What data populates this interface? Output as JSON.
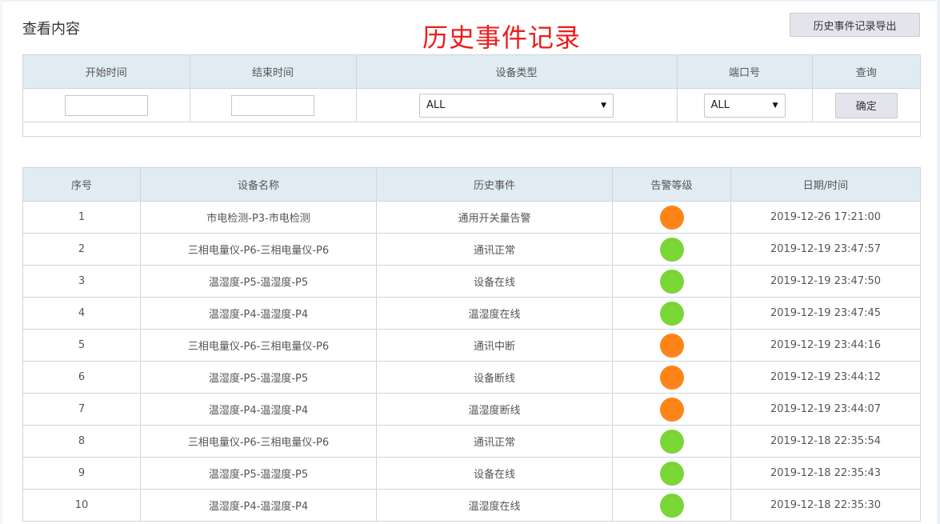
{
  "header": {
    "section_label": "查看内容",
    "title": "历史事件记录",
    "export_button": "历史事件记录导出"
  },
  "filters": {
    "headers": [
      "开始时间",
      "结束时间",
      "设备类型",
      "端口号",
      "查询"
    ],
    "start_time": "",
    "end_time": "",
    "device_type": "ALL",
    "port": "ALL",
    "confirm_button": "确定"
  },
  "table": {
    "headers": [
      "序号",
      "设备名称",
      "历史事件",
      "告警等级",
      "日期/时间"
    ],
    "level_colors": {
      "warning": "#fd8419",
      "normal": "#7ad634"
    },
    "rows": [
      {
        "no": "1",
        "device": "市电检测-P3-市电检测",
        "event": "通用开关量告警",
        "level": "warning",
        "datetime": "2019-12-26 17:21:00"
      },
      {
        "no": "2",
        "device": "三相电量仪-P6-三相电量仪-P6",
        "event": "通讯正常",
        "level": "normal",
        "datetime": "2019-12-19 23:47:57"
      },
      {
        "no": "3",
        "device": "温湿度-P5-温湿度-P5",
        "event": "设备在线",
        "level": "normal",
        "datetime": "2019-12-19 23:47:50"
      },
      {
        "no": "4",
        "device": "温湿度-P4-温湿度-P4",
        "event": "温湿度在线",
        "level": "normal",
        "datetime": "2019-12-19 23:47:45"
      },
      {
        "no": "5",
        "device": "三相电量仪-P6-三相电量仪-P6",
        "event": "通讯中断",
        "level": "warning",
        "datetime": "2019-12-19 23:44:16"
      },
      {
        "no": "6",
        "device": "温湿度-P5-温湿度-P5",
        "event": "设备断线",
        "level": "warning",
        "datetime": "2019-12-19 23:44:12"
      },
      {
        "no": "7",
        "device": "温湿度-P4-温湿度-P4",
        "event": "温湿度断线",
        "level": "warning",
        "datetime": "2019-12-19 23:44:07"
      },
      {
        "no": "8",
        "device": "三相电量仪-P6-三相电量仪-P6",
        "event": "通讯正常",
        "level": "normal",
        "datetime": "2019-12-18 22:35:54"
      },
      {
        "no": "9",
        "device": "温湿度-P5-温湿度-P5",
        "event": "设备在线",
        "level": "normal",
        "datetime": "2019-12-18 22:35:43"
      },
      {
        "no": "10",
        "device": "温湿度-P4-温湿度-P4",
        "event": "温湿度在线",
        "level": "normal",
        "datetime": "2019-12-18 22:35:30"
      }
    ]
  }
}
